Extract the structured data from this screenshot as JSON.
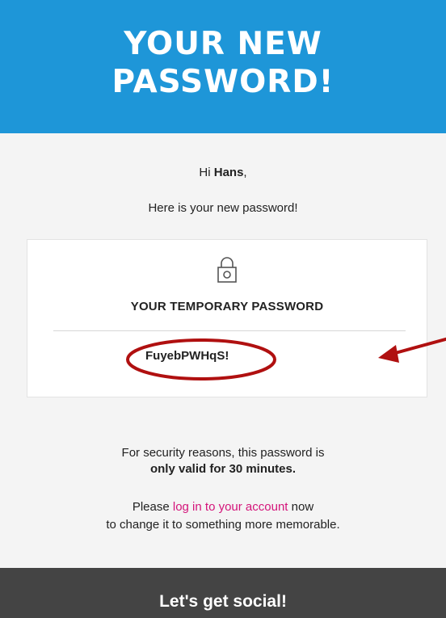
{
  "header": {
    "title_line1": "YOUR NEW",
    "title_line2": "PASSWORD!"
  },
  "greeting": {
    "prefix": "Hi ",
    "name": "Hans",
    "suffix": ","
  },
  "intro": "Here is your new password!",
  "card": {
    "icon": "lock-icon",
    "heading": "YOUR TEMPORARY PASSWORD",
    "password": "FuyebPWHqS!"
  },
  "security": {
    "line1": "For security reasons, this password is",
    "line2": "only valid for 30 minutes."
  },
  "login": {
    "prefix": "Please ",
    "link": "log in to your account",
    "suffix": " now",
    "line2": "to change it to something more memorable."
  },
  "footer": {
    "title": "Let's get social!"
  },
  "colors": {
    "hero": "#1e96d8",
    "link": "#d4147a",
    "annotation": "#b01010",
    "footer": "#444444"
  }
}
